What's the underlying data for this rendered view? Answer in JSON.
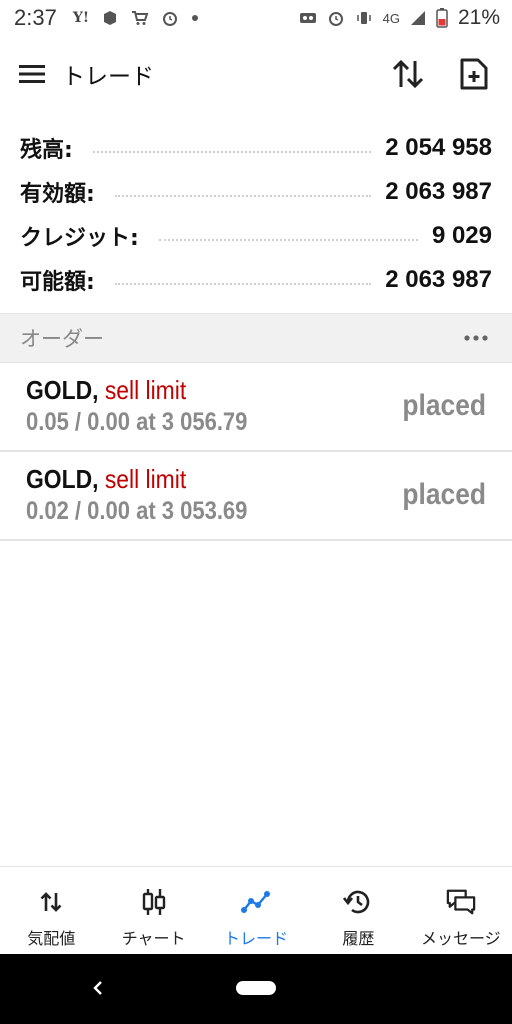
{
  "status_bar": {
    "time": "2:37",
    "notifications": [
      "yahoo-icon",
      "box-icon",
      "cart-icon",
      "alarm-icon",
      "dot-icon"
    ],
    "network": "4G",
    "battery_percent": "21%"
  },
  "app_bar": {
    "title": "トレード"
  },
  "account": [
    {
      "label": "残高:",
      "value": "2 054 958"
    },
    {
      "label": "有効額:",
      "value": "2 063 987"
    },
    {
      "label": "クレジット:",
      "value": "9 029"
    },
    {
      "label": "可能額:",
      "value": "2 063 987"
    }
  ],
  "orders_section": {
    "title": "オーダー"
  },
  "orders": [
    {
      "symbol": "GOLD,",
      "type": "sell limit",
      "detail": "0.05 / 0.00 at 3 056.79",
      "status": "placed"
    },
    {
      "symbol": "GOLD,",
      "type": "sell limit",
      "detail": "0.02 / 0.00 at 3 053.69",
      "status": "placed"
    }
  ],
  "bottom_nav": [
    {
      "label": "気配値",
      "icon": "quotes-arrows-icon"
    },
    {
      "label": "チャート",
      "icon": "candlestick-icon"
    },
    {
      "label": "トレード",
      "icon": "trade-line-icon",
      "active": true
    },
    {
      "label": "履歴",
      "icon": "history-icon"
    },
    {
      "label": "メッセージ",
      "icon": "messages-icon"
    }
  ],
  "colors": {
    "accent": "#1e7ae6",
    "sell": "#c20000",
    "muted": "#8a8a8a"
  }
}
